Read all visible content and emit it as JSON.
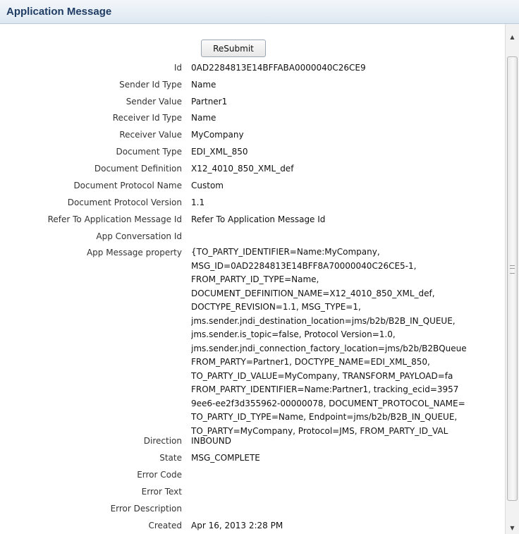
{
  "header": {
    "title": "Application Message"
  },
  "actions": {
    "resubmit_label": "ReSubmit"
  },
  "fields": {
    "id": {
      "label": "Id",
      "value": "0AD2284813E14BFFABA0000040C26CE9"
    },
    "sender_id_type": {
      "label": "Sender Id Type",
      "value": "Name"
    },
    "sender_value": {
      "label": "Sender Value",
      "value": "Partner1"
    },
    "receiver_id_type": {
      "label": "Receiver Id Type",
      "value": "Name"
    },
    "receiver_value": {
      "label": "Receiver Value",
      "value": "MyCompany"
    },
    "document_type": {
      "label": "Document Type",
      "value": "EDI_XML_850"
    },
    "document_definition": {
      "label": "Document Definition",
      "value": "X12_4010_850_XML_def"
    },
    "document_protocol_name": {
      "label": "Document Protocol Name",
      "value": "Custom"
    },
    "document_protocol_version": {
      "label": "Document Protocol Version",
      "value": "1.1"
    },
    "refer_to_app_msg_id": {
      "label": "Refer To Application Message Id",
      "value": "Refer To Application Message Id"
    },
    "app_conversation_id": {
      "label": "App Conversation Id",
      "value": ""
    },
    "app_message_property": {
      "label": "App Message property",
      "lines": [
        "{TO_PARTY_IDENTIFIER=Name:MyCompany,",
        "MSG_ID=0AD2284813E14BFF8A70000040C26CE5-1,",
        "FROM_PARTY_ID_TYPE=Name,",
        "DOCUMENT_DEFINITION_NAME=X12_4010_850_XML_def,",
        "DOCTYPE_REVISION=1.1, MSG_TYPE=1,",
        "jms.sender.jndi_destination_location=jms/b2b/B2B_IN_QUEUE,",
        "jms.sender.is_topic=false, Protocol Version=1.0,",
        "jms.sender.jndi_connection_factory_location=jms/b2b/B2BQueue",
        "FROM_PARTY=Partner1, DOCTYPE_NAME=EDI_XML_850,",
        "TO_PARTY_ID_VALUE=MyCompany, TRANSFORM_PAYLOAD=fa",
        "FROM_PARTY_IDENTIFIER=Name:Partner1, tracking_ecid=3957",
        "9ee6-ee2f3d355962-00000078, DOCUMENT_PROTOCOL_NAME=",
        "TO_PARTY_ID_TYPE=Name, Endpoint=jms/b2b/B2B_IN_QUEUE,",
        "TO_PARTY=MyCompany, Protocol=JMS, FROM_PARTY_ID_VAL"
      ]
    },
    "direction": {
      "label": "Direction",
      "value": "INBOUND"
    },
    "state": {
      "label": "State",
      "value": "MSG_COMPLETE"
    },
    "error_code": {
      "label": "Error Code",
      "value": ""
    },
    "error_text": {
      "label": "Error Text",
      "value": ""
    },
    "error_description": {
      "label": "Error Description",
      "value": ""
    },
    "created": {
      "label": "Created",
      "value": "Apr 16, 2013 2:28 PM"
    }
  },
  "scrollbar": {
    "up_icon": "▲",
    "down_icon": "▼"
  }
}
